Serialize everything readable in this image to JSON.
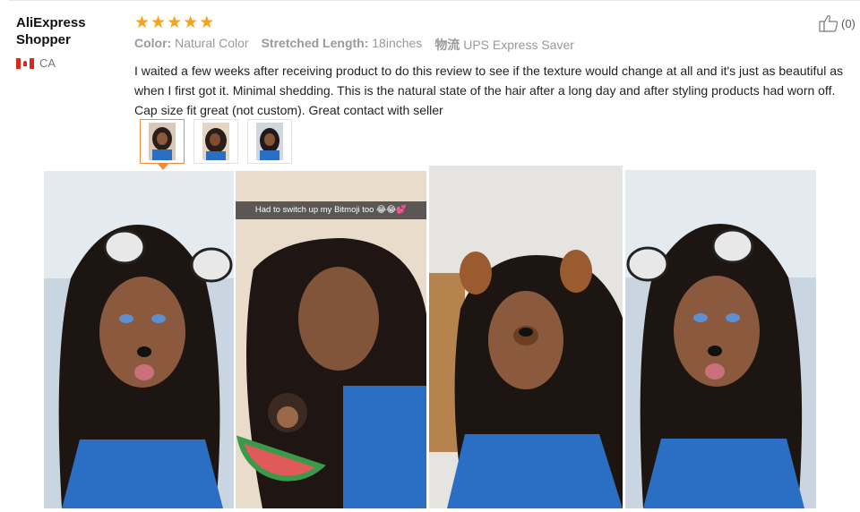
{
  "reviewer": {
    "name": "AliExpress Shopper",
    "country_code": "CA"
  },
  "review": {
    "rating": 5,
    "attributes": [
      {
        "label": "Color:",
        "value": "Natural Color"
      },
      {
        "label": "Stretched Length:",
        "value": "18inches"
      },
      {
        "label": "物流",
        "value": "UPS Express Saver"
      }
    ],
    "text": "I waited a few weeks after receiving product to do this review to see if the texture would change at all and it's just as beautiful as when I first got it. Minimal shedding. This is the natural state of the hair after a long day and after styling products had worn off. Cap size fit great (not custom). Great contact with seller"
  },
  "helpful": {
    "count_label": "(0)"
  },
  "thumbnails": {
    "count": 3,
    "active_index": 0
  },
  "photos": {
    "caption": "Had to switch up my Bitmoji too 😂😂💕"
  },
  "colors": {
    "star": "#f7a21b",
    "active_thumb_border": "#f08b3e",
    "shirt_blue": "#2a6fc4"
  },
  "icons": [
    "star-icon",
    "canada-flag-icon",
    "thumbs-up-icon"
  ]
}
